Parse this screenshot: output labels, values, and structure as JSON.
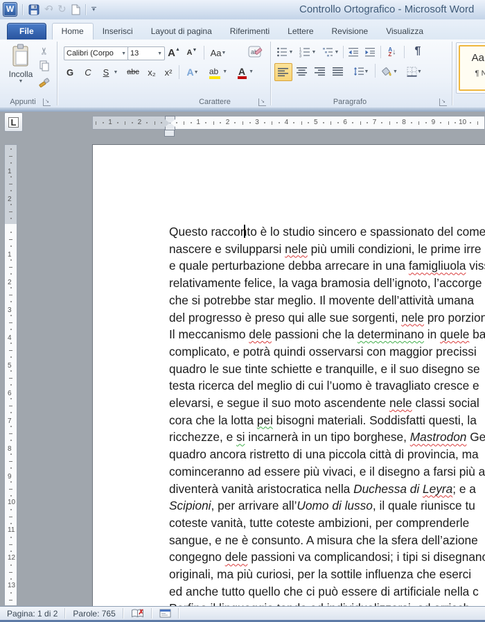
{
  "window": {
    "title": "Controllo Ortografico - Microsoft Word"
  },
  "tabs": [
    {
      "id": "file",
      "label": "File",
      "type": "file"
    },
    {
      "id": "home",
      "label": "Home",
      "active": true
    },
    {
      "id": "inserisci",
      "label": "Inserisci"
    },
    {
      "id": "layout-di-pagina",
      "label": "Layout di pagina"
    },
    {
      "id": "riferimenti",
      "label": "Riferimenti"
    },
    {
      "id": "lettere",
      "label": "Lettere"
    },
    {
      "id": "revisione",
      "label": "Revisione"
    },
    {
      "id": "visualizza",
      "label": "Visualizza"
    }
  ],
  "ribbon": {
    "clipboard": {
      "group": "Appunti",
      "paste": "Incolla"
    },
    "font": {
      "group": "Carattere",
      "name": "Calibri (Corpo",
      "size": "13",
      "bold": "G",
      "italic": "C",
      "underline": "S",
      "strike": "abc",
      "subscript": "x₂",
      "superscript": "x²",
      "grow": "A",
      "shrink": "A",
      "case": "Aa",
      "effects": "A",
      "highlight": "ab",
      "color": "A"
    },
    "paragraph": {
      "group": "Paragrafo",
      "pilcrow": "¶",
      "sort_a": "A",
      "sort_z": "Z"
    },
    "styles": {
      "preview": "AaBb",
      "name": "¶ Nor"
    }
  },
  "ruler": {
    "tab_selector": "L",
    "h_margin": [
      "2",
      "1"
    ],
    "h_main": [
      "1",
      "2",
      "3",
      "4",
      "5",
      "6",
      "7",
      "8",
      "9",
      "10"
    ],
    "v_margin": [
      "2",
      "1"
    ],
    "v_main": [
      "1",
      "2",
      "3",
      "4",
      "5",
      "6",
      "7",
      "8",
      "9",
      "10",
      "11",
      "12",
      "13"
    ]
  },
  "document": {
    "lines": [
      [
        [
          "Questo racconto è lo studio sincero e spassionato del come"
        ]
      ],
      [
        [
          "nascere e svilupparsi "
        ],
        [
          "nele",
          "r"
        ],
        [
          " più umili condizioni, le prime irre"
        ]
      ],
      [
        [
          "e quale perturbazione debba arrecare in una "
        ],
        [
          "famigliuola",
          "r"
        ],
        [
          " viss"
        ]
      ],
      [
        [
          "relativamente felice, la vaga bramosia dell’ignoto, l’accorge"
        ]
      ],
      [
        [
          "che si potrebbe star meglio. Il movente dell’attività umana"
        ]
      ],
      [
        [
          "del progresso è preso qui alle sue sorgenti, "
        ],
        [
          "nele",
          "r"
        ],
        [
          " pro porzioni"
        ]
      ],
      [
        [
          "Il meccanismo "
        ],
        [
          "dele",
          "r"
        ],
        [
          " passioni che la "
        ],
        [
          "determinano",
          "g"
        ],
        [
          " in "
        ],
        [
          "quele",
          "r"
        ],
        [
          " ba"
        ]
      ],
      [
        [
          "complicato, e potrà quindi osservarsi con maggior precissi"
        ]
      ],
      [
        [
          "quadro le sue tinte schiette e tranquille, e il suo disegno se"
        ]
      ],
      [
        [
          "testa ricerca del meglio di cui l’uomo è travagliato cresce e"
        ]
      ],
      [
        [
          "elevarsi, e segue il suo moto ascendente "
        ],
        [
          "nele",
          "r"
        ],
        [
          " classi social"
        ]
      ],
      [
        [
          "cora che la lotta "
        ],
        [
          "pei",
          "g"
        ],
        [
          " bisogni materiali. Soddisfatti questi, la"
        ]
      ],
      [
        [
          "ricchezze, e "
        ],
        [
          "si",
          "g"
        ],
        [
          " incarnerà in un tipo borghese, "
        ],
        [
          "Mastrodon",
          "ir"
        ],
        [
          " Ge"
        ]
      ],
      [
        [
          "quadro ancora ristretto di una piccola città di provincia, ma"
        ]
      ],
      [
        [
          "cominceranno ad essere più vivaci, e il disegno a farsi più a"
        ]
      ],
      [
        [
          "diventerà vanità aristocratica nella "
        ],
        [
          "Duchessa di ",
          "i"
        ],
        [
          "Leyra",
          "ir"
        ],
        [
          "; e a"
        ]
      ],
      [
        [
          "Scipioni",
          "i"
        ],
        [
          ", per arrivare all’"
        ],
        [
          "Uomo di lusso",
          "i"
        ],
        [
          ", il quale riunisce tu"
        ]
      ],
      [
        [
          "coteste vanità, tutte coteste ambizioni, per comprenderle"
        ]
      ],
      [
        [
          "sangue, e ne è consunto. A misura che la sfera dell’azione"
        ]
      ],
      [
        [
          "congegno "
        ],
        [
          "dele",
          "r"
        ],
        [
          " passioni va complicandosi; i tipi si disegnano"
        ]
      ],
      [
        [
          "originali, ma più curiosi, per la sottile influenza che eserci"
        ]
      ],
      [
        [
          "ed anche tutto quello che ci può essere di artificiale nella c"
        ]
      ],
      [
        [
          "Perfino il linguaggio tende ad individualizzarsi, ad arricch"
        ]
      ]
    ]
  },
  "status": {
    "page": "Pagina: 1 di 2",
    "words": "Parole: 765"
  },
  "colors": {
    "accent_blue": "#2d5a9e",
    "selection_orange": "#f7d478",
    "squiggle_red": "#d93a3a",
    "squiggle_green": "#3fae49",
    "highlight_yellow": "#ffe600",
    "font_color_red": "#c00000"
  }
}
